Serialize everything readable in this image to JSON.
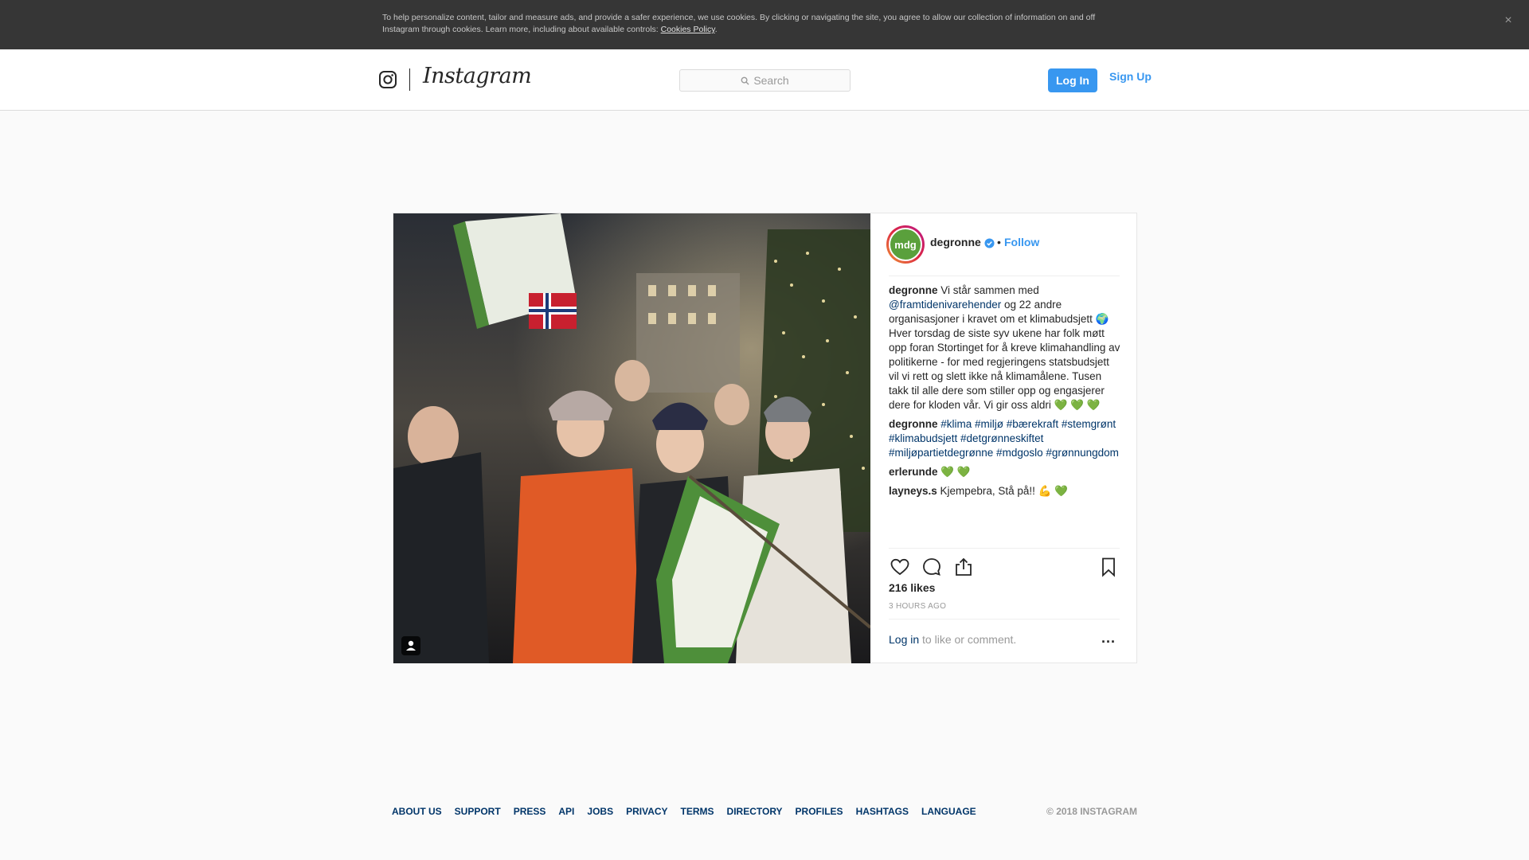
{
  "cookie_banner": {
    "text": "To help personalize content, tailor and measure ads, and provide a safer experience, we use cookies. By clicking or navigating the site, you agree to allow our collection of information on and off Instagram through cookies. Learn more, including about available controls: ",
    "link": "Cookies Policy",
    "after": ".",
    "close": "×"
  },
  "header": {
    "logo_text": "Instagram",
    "search_placeholder": "Search",
    "login": "Log In",
    "signup": "Sign Up"
  },
  "post": {
    "avatar_text": "mdg",
    "username": "degronne",
    "dot": "•",
    "follow": "Follow",
    "comments": [
      {
        "user": "degronne",
        "parts": [
          {
            "text": " Vi står sammen med ",
            "link": false
          },
          {
            "text": "@framtidenivarehender",
            "link": true
          },
          {
            "text": " og 22 andre organisasjoner i kravet om et klimabudsjett 🌍 Hver torsdag de siste syv ukene har folk møtt opp foran Stortinget for å kreve klimahandling av politikerne - for med regjeringens statsbudsjett vil vi rett og slett ikke nå klimamålene. Tusen takk til alle dere som stiller opp og engasjerer dere for kloden vår. Vi gir oss aldri 💚 💚 💚",
            "link": false
          }
        ]
      },
      {
        "user": "degronne",
        "parts": [
          {
            "text": " ",
            "link": false
          },
          {
            "text": "#klima #miljø #bærekraft #stemgrønt #klimabudsjett #detgrønneskiftet #miljøpartietdegrønne #mdgoslo #grønnungdom",
            "link": true
          }
        ]
      },
      {
        "user": "erlerunde",
        "parts": [
          {
            "text": " 💚 💚",
            "link": false
          }
        ]
      },
      {
        "user": "layneys.s",
        "parts": [
          {
            "text": " Kjempebra, Stå på!! 💪 💚",
            "link": false
          }
        ]
      }
    ],
    "likes": "216 likes",
    "time": "3 HOURS AGO",
    "login_link": "Log in",
    "login_rest": " to like or comment.",
    "more": "..."
  },
  "footer": {
    "links": [
      "ABOUT US",
      "SUPPORT",
      "PRESS",
      "API",
      "JOBS",
      "PRIVACY",
      "TERMS",
      "DIRECTORY",
      "PROFILES",
      "HASHTAGS",
      "LANGUAGE"
    ],
    "copyright": "© 2018 INSTAGRAM"
  },
  "colors": {
    "accent": "#3897f0",
    "link": "#003569",
    "banner": "#363636"
  },
  "icons": [
    "instagram-glyph-icon",
    "search-icon",
    "verified-icon",
    "heart-icon",
    "comment-icon",
    "share-icon",
    "bookmark-icon",
    "user-tag-icon",
    "close-icon"
  ]
}
